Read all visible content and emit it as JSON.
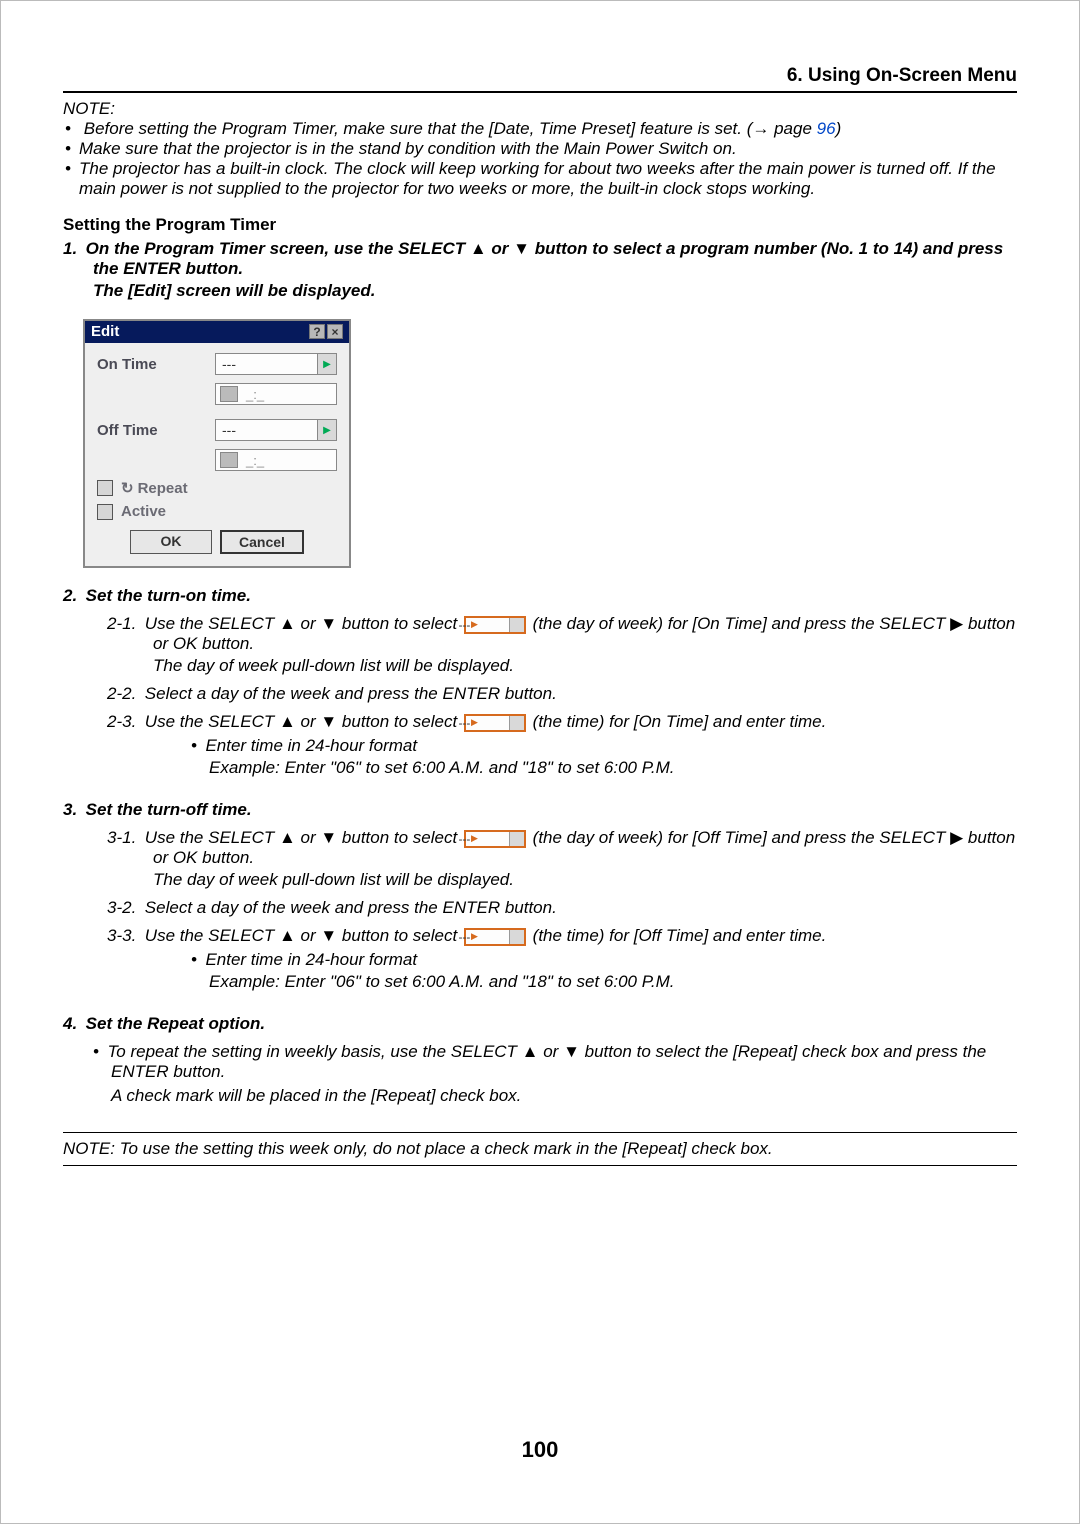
{
  "header": {
    "section": "6. Using On-Screen Menu"
  },
  "note": {
    "label": "NOTE:",
    "items": [
      "Before setting the Program Timer, make sure that the [Date, Time Preset] feature is set. (→ page ",
      "Make sure that the projector is in the stand by condition with the Main Power Switch on.",
      "The projector has a built-in clock. The clock will keep working for about two weeks after the main power is turned off. If the main power is not supplied to the projector for two weeks or more, the built-in clock stops working."
    ],
    "page_ref": "96",
    "close_paren": ")"
  },
  "setting": {
    "title": "Setting the Program Timer",
    "step1_pre": "1. On the Program Timer screen, use the SELECT ",
    "step1_mid": " or ",
    "step1_post": " button to select a program number (No. 1 to 14) and press the ENTER button.",
    "step1_sub": "The [Edit] screen will be displayed."
  },
  "dialog": {
    "title": "Edit",
    "on_time": "On Time",
    "off_time": "Off Time",
    "placeholder": "---",
    "time_placeholder": "_:_",
    "repeat": "Repeat",
    "active": "Active",
    "ok": "OK",
    "cancel": "Cancel"
  },
  "step2": {
    "title": "2. Set the turn-on time.",
    "s21a": "2-1. Use the SELECT ",
    "s21b": " or ",
    "s21c": " button to select ",
    "s21d": " (the day of week) for [On Time] and press the SELECT ",
    "s21e": " button or OK button.",
    "s21sub": "The day of week pull-down list will be displayed.",
    "s22": "2-2. Select a day of the week and press the ENTER button.",
    "s23a": "2-3. Use the SELECT ",
    "s23b": " or ",
    "s23c": " button to select ",
    "s23d": " (the time) for [On Time] and enter time.",
    "s23_b1": "• Enter time in 24-hour format",
    "s23_b2": "Example: Enter \"06\" to set 6:00 A.M. and \"18\" to set 6:00 P.M."
  },
  "step3": {
    "title": "3. Set the turn-off time.",
    "s31a": "3-1. Use the SELECT ",
    "s31b": " or ",
    "s31c": " button to select ",
    "s31d": " (the day of week) for [Off Time] and press the SELECT ",
    "s31e": " button or OK button.",
    "s31sub": "The day of week pull-down list will be displayed.",
    "s32": "3-2. Select a day of the week and press the ENTER button.",
    "s33a": "3-3. Use the SELECT ",
    "s33b": " or ",
    "s33c": " button to select ",
    "s33d": " (the time) for [Off Time] and enter time.",
    "s33_b1": "• Enter time in 24-hour format",
    "s33_b2": "Example: Enter \"06\" to set 6:00 A.M. and \"18\" to set 6:00 P.M."
  },
  "step4": {
    "title": "4. Set the Repeat option.",
    "b1a": "• To repeat the setting in weekly basis, use the SELECT ",
    "b1b": " or ",
    "b1c": " button to select the [Repeat] check box and press the ENTER button.",
    "b2": "A check mark will be placed in the [Repeat] check box."
  },
  "note2": "NOTE: To use the setting this week only, do not place a check mark in the [Repeat] check box.",
  "glyph": {
    "up": "▲",
    "down": "▼",
    "right": "▶",
    "dash": "---",
    "repeat": "↻"
  },
  "page_number": "100"
}
